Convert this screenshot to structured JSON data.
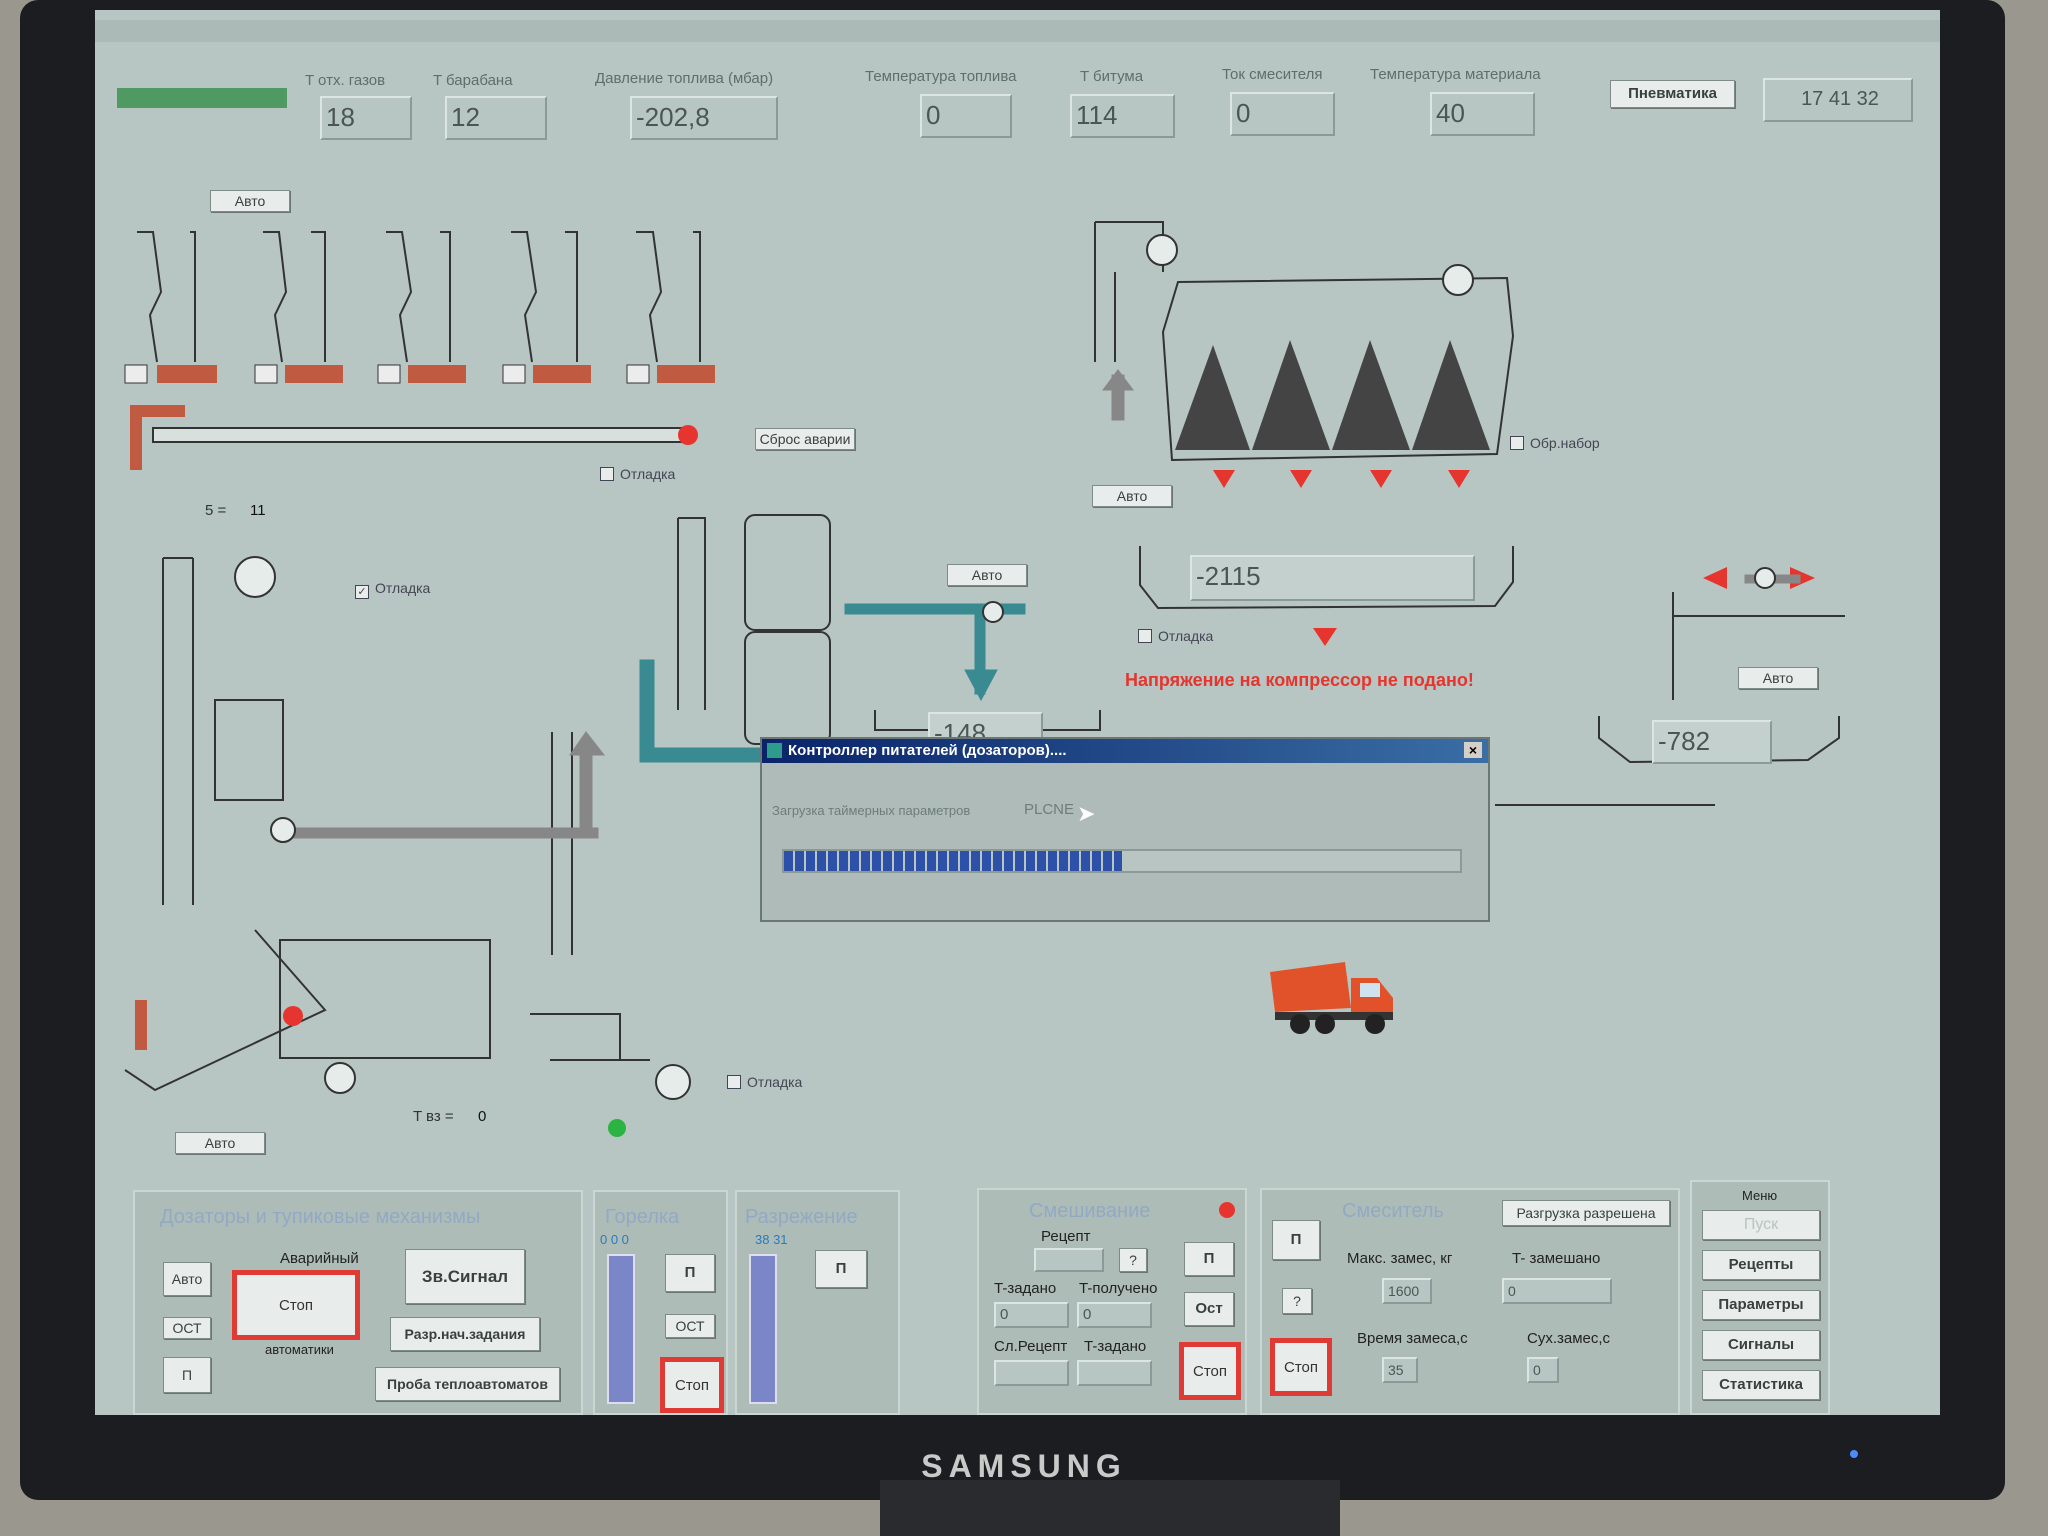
{
  "header": {
    "labels": [
      "T отх. газов",
      "T барабана",
      "Давление топлива (мбар)",
      "Температура топлива",
      "T битума",
      "Ток смесителя",
      "Температура материала"
    ],
    "values": [
      "18",
      "12",
      "-202,8",
      "0",
      "114",
      "0",
      "40"
    ],
    "pneumatics_button": "Пневматика",
    "clock": "17 41 32"
  },
  "buttons": {
    "auto": "Авто",
    "reset_alarm": "Сброс аварии"
  },
  "checkboxes": {
    "debug": "Отладка",
    "obr_nabor": "Обр.набор"
  },
  "counter_label": "5 =",
  "counter_value": "11",
  "tbz_label": "T вз =",
  "tbz_value": "0",
  "hopper_values": [
    "-2115",
    "-148",
    "-782"
  ],
  "warning": "Напряжение на компрессор не подано!",
  "dialog": {
    "title": "Контроллер питателей (дозаторов)....",
    "message": "Загрузка таймерных параметров",
    "device": "PLCNE",
    "progress": 0.5
  },
  "bottom": {
    "panel1_title": "Дозаторы и тупиковые механизмы",
    "auto": "Авто",
    "ost": "ОСТ",
    "p": "П",
    "emergency_top": "Аварийный",
    "stop": "Стоп",
    "automatics": "автоматики",
    "sound_signal": "Зв.Сигнал",
    "start_tasks": "Разр.нач.задания",
    "heat_test": "Проба теплоавтоматов",
    "burner_title": "Горелка",
    "burner_ticks": "0   0   0",
    "rarefaction_title": "Разрежение",
    "rarefaction_ticks": "38  31",
    "ost2": "ОСТ",
    "mixing_title": "Смешивание",
    "recipe_label": "Рецепт",
    "q": "?",
    "t_set": "T-задано",
    "t_got": "T-получено",
    "t_set_val": "0",
    "t_got_val": "0",
    "next_recipe": "Сл.Рецепт",
    "t_set2": "T-задано",
    "ost3": "Ост",
    "mixer_title": "Смеситель",
    "unload_allowed": "Разгрузка разрешена",
    "max_batch": "Макс. замес, кг",
    "t_mixed": "T- замешано",
    "max_batch_val": "1600",
    "t_mixed_val": "0",
    "mix_time": "Время замеса,с",
    "dry_mix": "Сух.замес,с",
    "mix_time_val": "35",
    "dry_mix_val": "0"
  },
  "menu": {
    "title": "Меню",
    "items": [
      "Пуск",
      "Рецепты",
      "Параметры",
      "Сигналы",
      "Статистика"
    ]
  },
  "monitor_brand": "SAMSUNG"
}
